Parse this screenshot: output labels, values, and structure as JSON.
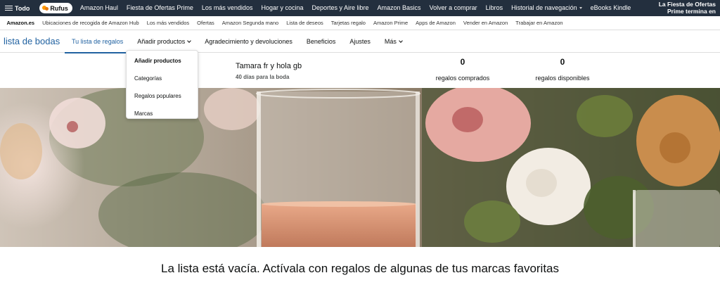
{
  "topnav": {
    "all_label": "Todo",
    "rufus_label": "Rufus",
    "items": [
      {
        "label": "Amazon Haul",
        "caret": false
      },
      {
        "label": "Fiesta de Ofertas Prime",
        "caret": false
      },
      {
        "label": "Los más vendidos",
        "caret": false
      },
      {
        "label": "Hogar y cocina",
        "caret": false
      },
      {
        "label": "Deportes y Aire libre",
        "caret": false
      },
      {
        "label": "Amazon Basics",
        "caret": false
      },
      {
        "label": "Volver a comprar",
        "caret": false
      },
      {
        "label": "Libros",
        "caret": false
      },
      {
        "label": "Historial de navegación",
        "caret": true
      },
      {
        "label": "eBooks Kindle",
        "caret": false
      }
    ],
    "promo_line1": "La Fiesta de Ofertas",
    "promo_line2": "Prime termina en"
  },
  "subnav": {
    "items": [
      "Amazon.es",
      "Ubicaciones de recogida de Amazon Hub",
      "Los más vendidos",
      "Ofertas",
      "Amazon Segunda mano",
      "Lista de deseos",
      "Tarjetas regalo",
      "Amazon Prime",
      "Apps de Amazon",
      "Vender en Amazon",
      "Trabajar en Amazon"
    ]
  },
  "registry_nav": {
    "title": "lista de bodas",
    "tabs": [
      {
        "label": "Tu lista de regalos",
        "active": true,
        "chevron": false
      },
      {
        "label": "Añadir productos",
        "active": false,
        "chevron": true
      },
      {
        "label": "Agradecimiento y devoluciones",
        "active": false,
        "chevron": false
      },
      {
        "label": "Beneficios",
        "active": false,
        "chevron": false
      },
      {
        "label": "Ajustes",
        "active": false,
        "chevron": false
      },
      {
        "label": "Más",
        "active": false,
        "chevron": true
      }
    ]
  },
  "info": {
    "couple": "Tamara fr y hola gb",
    "days": "40 días para la boda",
    "purchased_count": "0",
    "purchased_label": "regalos comprados",
    "available_count": "0",
    "available_label": "regalos disponibles"
  },
  "dropdown": {
    "header": "Añadir productos",
    "items": [
      "Categorías",
      "Regalos populares",
      "Marcas"
    ]
  },
  "empty_message": "La lista está vacía. Actívala con regalos de algunas de tus marcas favoritas",
  "colors": {
    "nav_bg": "#232f3e",
    "link_blue": "#2162a1",
    "rufus_orange": "#ff9900"
  }
}
